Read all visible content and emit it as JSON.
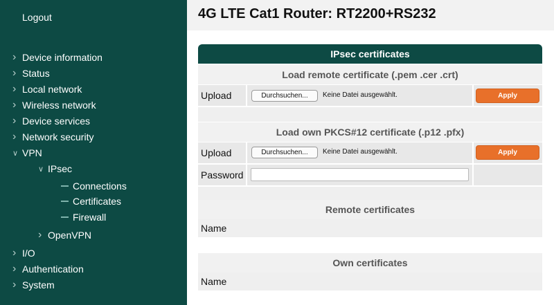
{
  "sidebar": {
    "logout": "Logout",
    "items": [
      {
        "label": "Device information"
      },
      {
        "label": "Status"
      },
      {
        "label": "Local network"
      },
      {
        "label": "Wireless network"
      },
      {
        "label": "Device services"
      },
      {
        "label": "Network security"
      },
      {
        "label": "VPN"
      },
      {
        "label": "IPsec"
      },
      {
        "label": "Connections"
      },
      {
        "label": "Certificates"
      },
      {
        "label": "Firewall"
      },
      {
        "label": "OpenVPN"
      },
      {
        "label": "I/O"
      },
      {
        "label": "Authentication"
      },
      {
        "label": "System"
      }
    ]
  },
  "header": {
    "title": "4G LTE Cat1 Router: RT2200+RS232"
  },
  "panel": {
    "title": "IPsec certificates",
    "remote_load": {
      "title": "Load remote certificate (.pem .cer .crt)",
      "upload_label": "Upload",
      "browse_label": "Durchsuchen...",
      "file_status": "Keine Datei ausgewählt.",
      "apply_label": "Apply"
    },
    "own_load": {
      "title": "Load own PKCS#12 certificate (.p12 .pfx)",
      "upload_label": "Upload",
      "browse_label": "Durchsuchen...",
      "file_status": "Keine Datei ausgewählt.",
      "apply_label": "Apply",
      "password_label": "Password",
      "password_value": ""
    },
    "remote_certs": {
      "title": "Remote certificates",
      "name_label": "Name"
    },
    "own_certs": {
      "title": "Own certificates",
      "name_label": "Name"
    }
  },
  "colors": {
    "sidebar_bg": "#0d4a44",
    "accent_button": "#e8702a"
  }
}
